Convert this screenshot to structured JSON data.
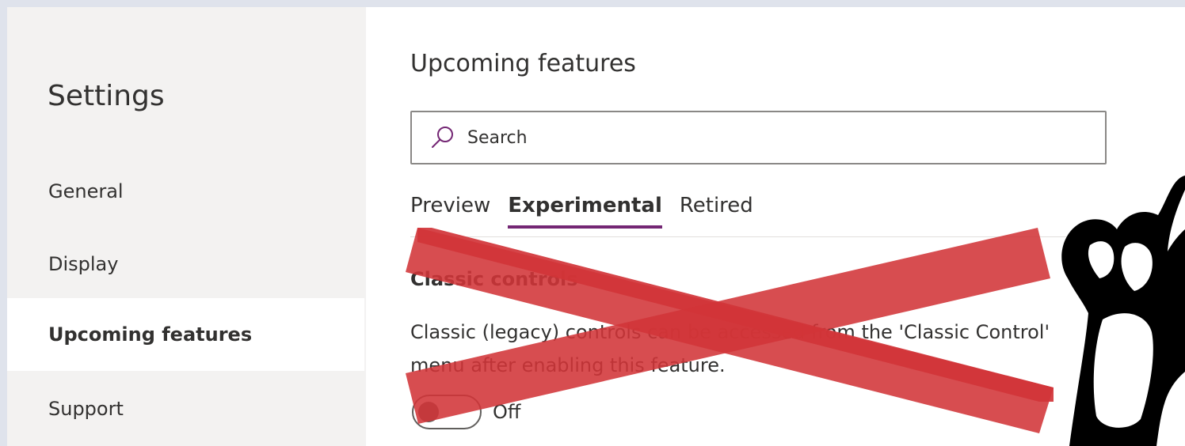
{
  "sidebar": {
    "title": "Settings",
    "items": [
      {
        "label": "General",
        "active": false
      },
      {
        "label": "Display",
        "active": false
      },
      {
        "label": "Upcoming features",
        "active": true
      },
      {
        "label": "Support",
        "active": false
      }
    ]
  },
  "main": {
    "title": "Upcoming features",
    "search": {
      "placeholder": "Search",
      "value": ""
    },
    "tabs": [
      {
        "label": "Preview",
        "active": false
      },
      {
        "label": "Experimental",
        "active": true
      },
      {
        "label": "Retired",
        "active": false
      }
    ],
    "feature": {
      "title": "Classic controls",
      "description": "Classic (legacy) controls can be accessed from the 'Classic Control' menu after enabling this feature.",
      "toggle_state": "Off",
      "enabled": false
    }
  },
  "overlay": {
    "cross_color": "#d13438",
    "mascot_icon": "raised-fist-icon"
  },
  "colors": {
    "accent": "#742774",
    "sidebar_bg": "#f3f2f1",
    "page_bg": "#dfe3ec"
  }
}
